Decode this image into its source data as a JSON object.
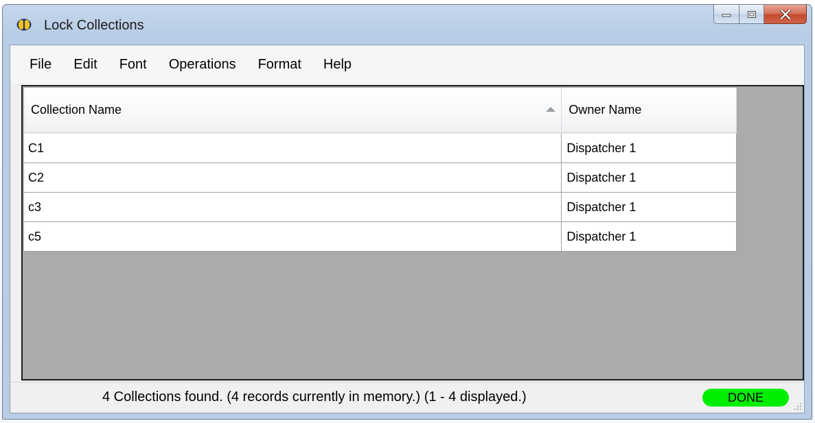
{
  "window": {
    "title": "Lock Collections",
    "app_icon": "app-logo-icon",
    "controls": [
      "minimize-icon",
      "maximize-icon",
      "close-icon"
    ]
  },
  "menu": {
    "items": [
      "File",
      "Edit",
      "Font",
      "Operations",
      "Format",
      "Help"
    ]
  },
  "table": {
    "columns": [
      "Collection Name",
      "Owner Name"
    ],
    "sort": {
      "column": "Collection Name",
      "direction": "ascending"
    },
    "rows": [
      [
        "C1",
        "Dispatcher 1"
      ],
      [
        "C2",
        "Dispatcher 1"
      ],
      [
        "c3",
        "Dispatcher 1"
      ],
      [
        "c5",
        "Dispatcher 1"
      ]
    ]
  },
  "status": {
    "text": "4 Collections found.  (4 records currently in memory.)  (1 - 4 displayed.)",
    "badge": "DONE",
    "badge_color": "#00ee00"
  }
}
